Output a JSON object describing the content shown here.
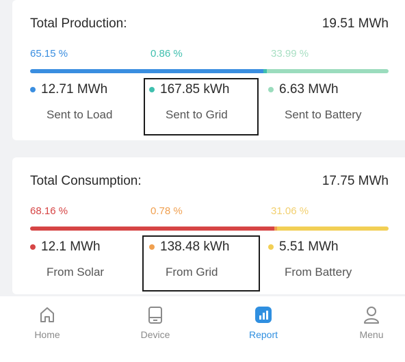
{
  "production": {
    "title": "Total Production:",
    "total": "19.51 MWh",
    "segments": [
      {
        "percent_label": "65.15 %",
        "percent": 65.15,
        "color": "#3a8ee0",
        "value": "12.71 MWh",
        "label": "Sent to Load"
      },
      {
        "percent_label": "0.86 %",
        "percent": 0.86,
        "color": "#3fbfae",
        "value": "167.85 kWh",
        "label": "Sent to Grid"
      },
      {
        "percent_label": "33.99 %",
        "percent": 33.99,
        "color": "#9bdcbd",
        "value": "6.63 MWh",
        "label": "Sent to Battery"
      }
    ]
  },
  "consumption": {
    "title": "Total Consumption:",
    "total": "17.75 MWh",
    "segments": [
      {
        "percent_label": "68.16 %",
        "percent": 68.16,
        "color": "#d64545",
        "value": "12.1 MWh",
        "label": "From Solar"
      },
      {
        "percent_label": "0.78 %",
        "percent": 0.78,
        "color": "#f0a050",
        "value": "138.48 kWh",
        "label": "From Grid"
      },
      {
        "percent_label": "31.06 %",
        "percent": 31.06,
        "color": "#f2cf55",
        "value": "5.51 MWh",
        "label": "From Battery"
      }
    ]
  },
  "nav": {
    "items": [
      {
        "label": "Home",
        "icon": "home-icon"
      },
      {
        "label": "Device",
        "icon": "device-icon"
      },
      {
        "label": "Report",
        "icon": "report-icon",
        "active": true
      },
      {
        "label": "Menu",
        "icon": "user-icon"
      }
    ],
    "active_color": "#2f8fe0"
  }
}
